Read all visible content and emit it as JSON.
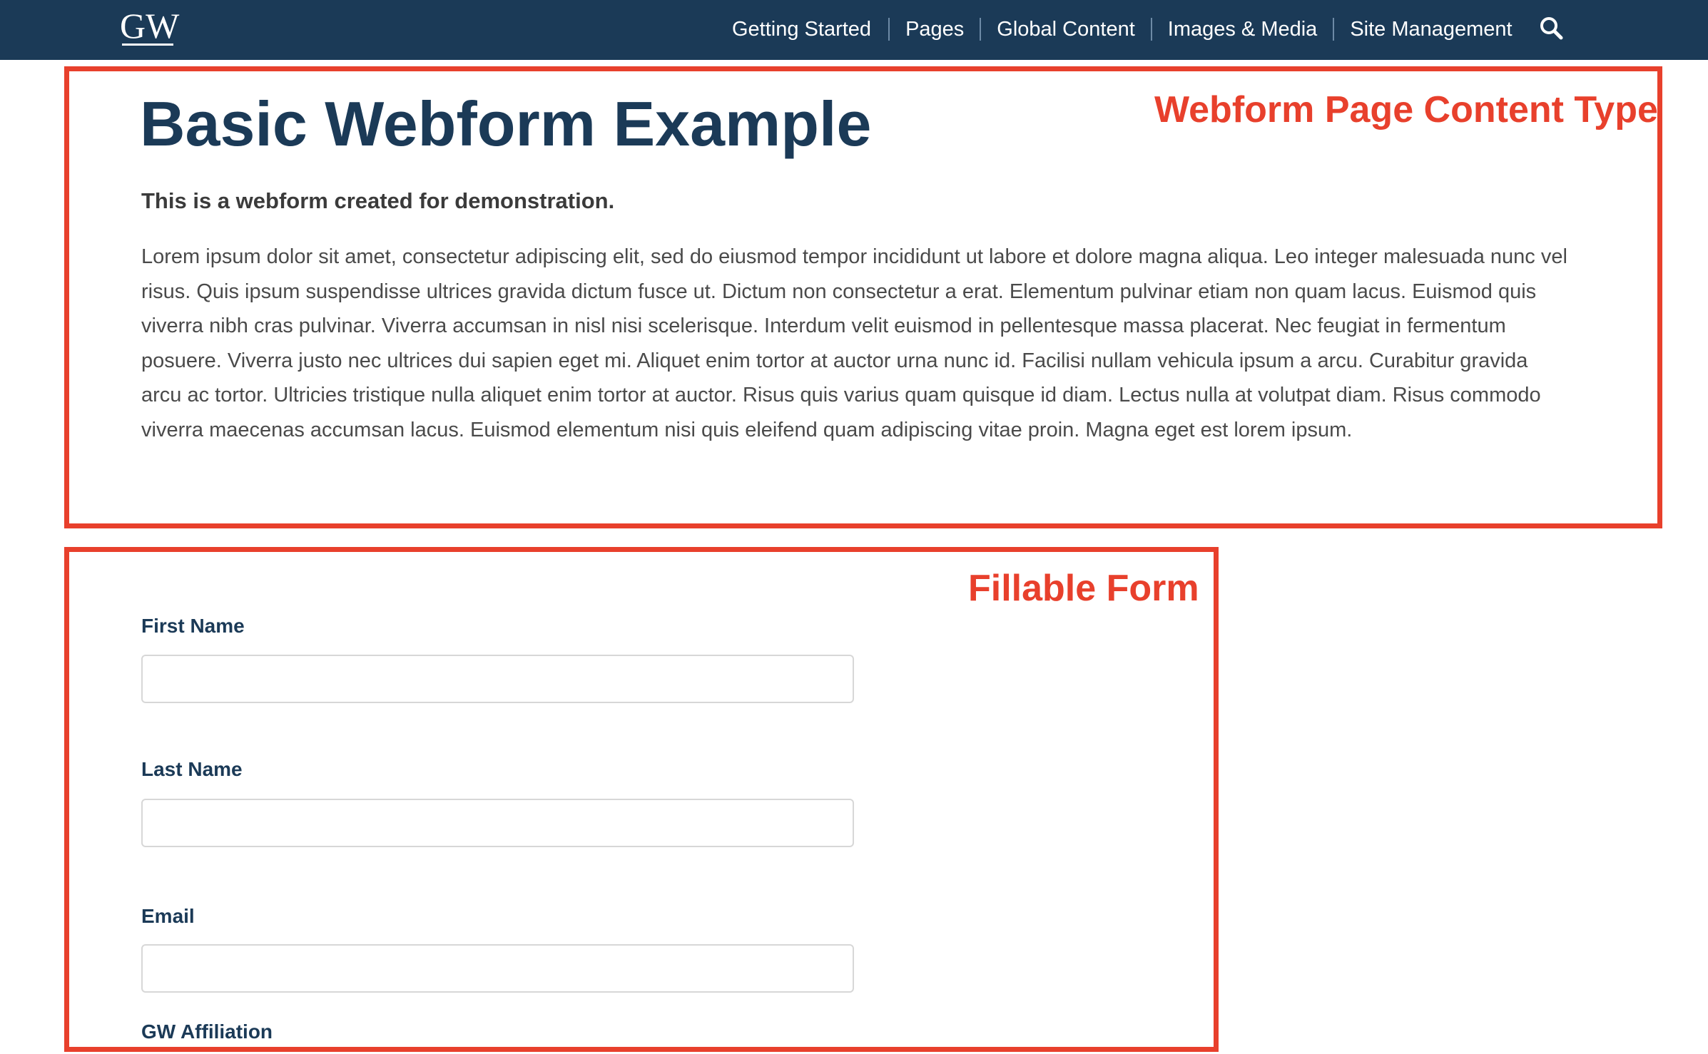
{
  "header": {
    "logo_text": "GW",
    "nav_items": [
      "Getting Started",
      "Pages",
      "Global Content",
      "Images & Media",
      "Site Management"
    ],
    "search_icon": "search-icon"
  },
  "annotations": {
    "content_type_label": "Webform Page Content Type",
    "form_label": "Fillable Form",
    "color": "#e8402c"
  },
  "main": {
    "title": "Basic Webform Example",
    "intro": "This is a webform created for demonstration.",
    "body": "Lorem ipsum dolor sit amet, consectetur adipiscing elit, sed do eiusmod tempor incididunt ut labore et dolore magna aliqua. Leo integer malesuada nunc vel risus. Quis ipsum suspendisse ultrices gravida dictum fusce ut. Dictum non consectetur a erat. Elementum pulvinar etiam non quam lacus. Euismod quis viverra nibh cras pulvinar. Viverra accumsan in nisl nisi scelerisque. Interdum velit euismod in pellentesque massa placerat. Nec feugiat in fermentum posuere. Viverra justo nec ultrices dui sapien eget mi. Aliquet enim tortor at auctor urna nunc id. Facilisi nullam vehicula ipsum a arcu. Curabitur gravida arcu ac tortor. Ultricies tristique nulla aliquet enim tortor at auctor. Risus quis varius quam quisque id diam. Lectus nulla at volutpat diam. Risus commodo viverra maecenas accumsan lacus. Euismod elementum nisi quis eleifend quam adipiscing vitae proin. Magna eget est lorem ipsum."
  },
  "form": {
    "first_name_label": "First Name",
    "first_name_value": "",
    "last_name_label": "Last Name",
    "last_name_value": "",
    "email_label": "Email",
    "email_value": "",
    "affiliation_label": "GW Affiliation"
  },
  "colors": {
    "header_bg": "#1b3a57",
    "title": "#1b3a57",
    "annotation": "#e8402c"
  }
}
